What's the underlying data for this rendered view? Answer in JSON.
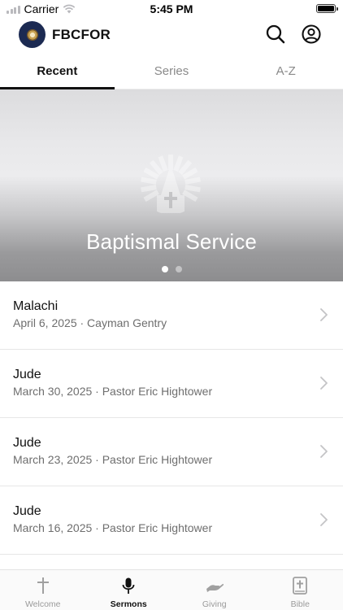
{
  "status_bar": {
    "carrier": "Carrier",
    "time": "5:45 PM"
  },
  "header": {
    "title": "FBCFOR"
  },
  "tabs": [
    {
      "label": "Recent",
      "active": true
    },
    {
      "label": "Series",
      "active": false
    },
    {
      "label": "A-Z",
      "active": false
    }
  ],
  "hero": {
    "title": "Baptismal Service",
    "page_count": 2,
    "current_page": 1
  },
  "sermons": [
    {
      "title": "Malachi",
      "meta": "April 6, 2025 · Cayman Gentry"
    },
    {
      "title": "Jude",
      "meta": "March 30, 2025 · Pastor Eric Hightower"
    },
    {
      "title": "Jude",
      "meta": "March 23, 2025 · Pastor Eric Hightower"
    },
    {
      "title": "Jude",
      "meta": "March 16, 2025 · Pastor Eric Hightower"
    }
  ],
  "tabbar": [
    {
      "label": "Welcome",
      "icon": "cross-icon",
      "active": false
    },
    {
      "label": "Sermons",
      "icon": "microphone-icon",
      "active": true
    },
    {
      "label": "Giving",
      "icon": "giving-hand-icon",
      "active": false
    },
    {
      "label": "Bible",
      "icon": "bible-icon",
      "active": false
    }
  ],
  "colors": {
    "text_primary": "#111111",
    "text_secondary": "#6e6e6e",
    "logo_background": "#1c2a52",
    "tab_inactive": "#9a9a9a"
  }
}
